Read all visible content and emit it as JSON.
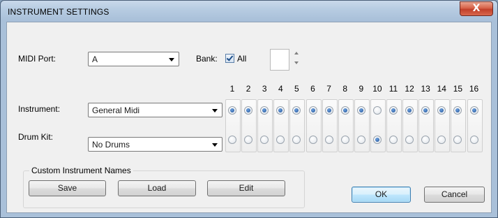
{
  "window": {
    "title": "INSTRUMENT SETTINGS",
    "close_glyph": "X"
  },
  "midi_port": {
    "label": "MIDI Port:",
    "value": "A"
  },
  "bank": {
    "label": "Bank:",
    "all_label": "All",
    "all_checked": true,
    "spin_value": ""
  },
  "channels": [
    "1",
    "2",
    "3",
    "4",
    "5",
    "6",
    "7",
    "8",
    "9",
    "10",
    "11",
    "12",
    "13",
    "14",
    "15",
    "16"
  ],
  "instrument": {
    "label": "Instrument:",
    "value": "General Midi",
    "selected_channels": [
      1,
      2,
      3,
      4,
      5,
      6,
      7,
      8,
      9,
      11,
      12,
      13,
      14,
      15,
      16
    ]
  },
  "drum_kit": {
    "label": "Drum Kit:",
    "value": "No Drums",
    "selected_channels": [
      10
    ]
  },
  "custom_names": {
    "title": "Custom Instrument Names",
    "save_label": "Save",
    "load_label": "Load",
    "edit_label": "Edit"
  },
  "dialog_buttons": {
    "ok_label": "OK",
    "cancel_label": "Cancel"
  },
  "colors": {
    "accent": "#3c7fb1",
    "radio_on": "#1d4f95",
    "close": "#c1402a"
  }
}
